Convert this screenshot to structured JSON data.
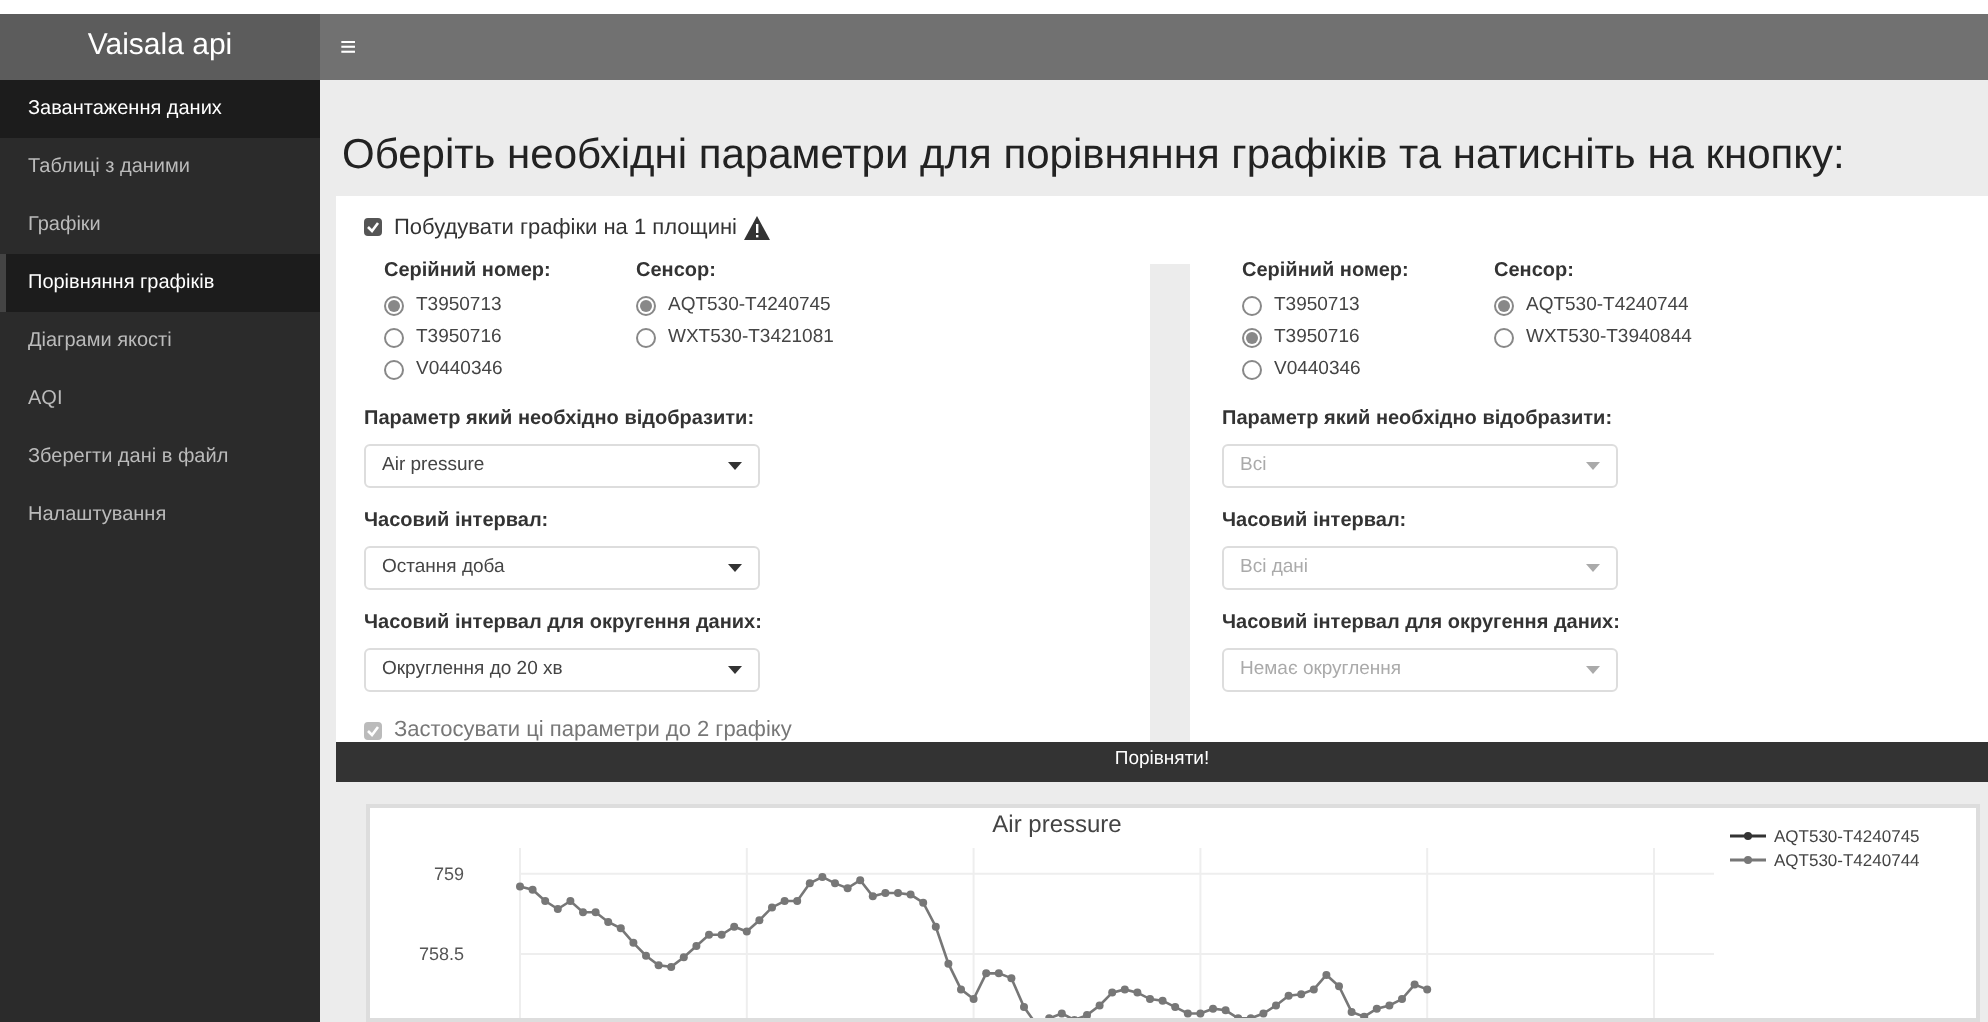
{
  "header": {
    "brand": "Vaisala api",
    "menu_icon": "≡"
  },
  "sidebar": {
    "items": [
      {
        "label": "Завантаження даних",
        "selected": false,
        "highlighted": true
      },
      {
        "label": "Таблиці з даними",
        "selected": false,
        "highlighted": false
      },
      {
        "label": "Графіки",
        "selected": false,
        "highlighted": false
      },
      {
        "label": "Порівняння графіків",
        "selected": true,
        "highlighted": true
      },
      {
        "label": "Діаграми якості",
        "selected": false,
        "highlighted": false
      },
      {
        "label": "AQI",
        "selected": false,
        "highlighted": false
      },
      {
        "label": "Зберегти дані в файл",
        "selected": false,
        "highlighted": false
      },
      {
        "label": "Налаштування",
        "selected": false,
        "highlighted": false
      }
    ]
  },
  "page_title": "Оберіть необхідні параметри для порівняння графіків та натисніть на кнопку:",
  "single_plane": {
    "label": "Побудувати графіки на 1 площині",
    "checked": true
  },
  "panels": [
    {
      "serial": {
        "label": "Серійний номер:",
        "options": [
          {
            "label": "T3950713",
            "selected": true
          },
          {
            "label": "T3950716",
            "selected": false
          },
          {
            "label": "V0440346",
            "selected": false
          }
        ]
      },
      "sensor": {
        "label": "Сенсор:",
        "options": [
          {
            "label": "AQT530-T4240745",
            "selected": true
          },
          {
            "label": "WXT530-T3421081",
            "selected": false
          }
        ]
      },
      "selects": [
        {
          "label": "Параметр який необхідно відобразити:",
          "value": "Air pressure",
          "disabled": false
        },
        {
          "label": "Часовий інтервал:",
          "value": "Остання доба",
          "disabled": false
        },
        {
          "label": "Часовий інтервал для округення даних:",
          "value": "Округлення до 20 хв",
          "disabled": false
        }
      ],
      "apply": {
        "label": "Застосувати ці параметри до 2 графіку",
        "checked": true,
        "disabled": true
      }
    },
    {
      "serial": {
        "label": "Серійний номер:",
        "options": [
          {
            "label": "T3950713",
            "selected": false
          },
          {
            "label": "T3950716",
            "selected": true
          },
          {
            "label": "V0440346",
            "selected": false
          }
        ]
      },
      "sensor": {
        "label": "Сенсор:",
        "options": [
          {
            "label": "AQT530-T4240744",
            "selected": true
          },
          {
            "label": "WXT530-T3940844",
            "selected": false
          }
        ]
      },
      "selects": [
        {
          "label": "Параметр який необхідно відобразити:",
          "value": "Всі",
          "disabled": true
        },
        {
          "label": "Часовий інтервал:",
          "value": "Всі дані",
          "disabled": true
        },
        {
          "label": "Часовий інтервал для округення даних:",
          "value": "Немає округлення",
          "disabled": true
        }
      ]
    }
  ],
  "compare_button": "Порівняти!",
  "chart": {
    "chart_data": {
      "type": "line",
      "title": "Air pressure",
      "ylim": [
        757.99,
        759.16
      ],
      "yticks": [
        758.5,
        759
      ],
      "grid": true,
      "legend": true,
      "series": [
        {
          "name": "AQT530-T4240745",
          "color": "#333333",
          "marker": "circle"
        },
        {
          "name": "AQT530-T4240744",
          "color": "#777777",
          "marker": "circle",
          "values": [
            758.92,
            758.9,
            758.83,
            758.78,
            758.83,
            758.76,
            758.76,
            758.7,
            758.66,
            758.57,
            758.49,
            758.43,
            758.42,
            758.48,
            758.55,
            758.62,
            758.62,
            758.67,
            758.64,
            758.71,
            758.79,
            758.83,
            758.83,
            758.94,
            758.98,
            758.94,
            758.91,
            758.96,
            758.86,
            758.88,
            758.88,
            758.87,
            758.82,
            758.67,
            758.44,
            758.28,
            758.22,
            758.38,
            758.38,
            758.35,
            758.17,
            758.06,
            758.1,
            758.13,
            758.09,
            758.12,
            758.18,
            758.26,
            758.28,
            758.26,
            758.22,
            758.21,
            758.17,
            758.13,
            758.13,
            758.16,
            758.15,
            758.1,
            758.1,
            758.13,
            758.18,
            758.24,
            758.25,
            758.28,
            758.37,
            758.3,
            758.14,
            758.11,
            758.16,
            758.18,
            758.22,
            758.31,
            758.28
          ]
        }
      ]
    }
  }
}
